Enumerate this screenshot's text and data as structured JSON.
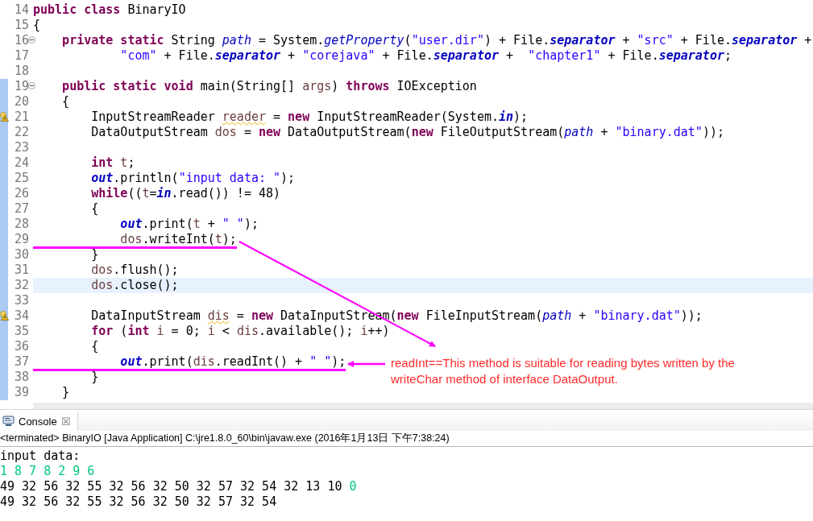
{
  "editor": {
    "lines": [
      {
        "number": "14",
        "changed": false,
        "fold": false,
        "warning": false,
        "current": false,
        "underlined": false,
        "tokens": [
          {
            "text": "public class",
            "kind": "keyword"
          },
          {
            "text": " BinaryIO",
            "kind": "plain"
          }
        ]
      },
      {
        "number": "15",
        "changed": false,
        "fold": false,
        "warning": false,
        "current": false,
        "underlined": false,
        "tokens": [
          {
            "text": "{",
            "kind": "plain"
          }
        ]
      },
      {
        "number": "16",
        "changed": false,
        "fold": true,
        "warning": false,
        "current": false,
        "underlined": false,
        "tokens": [
          {
            "text": "    private static",
            "kind": "keyword"
          },
          {
            "text": " String ",
            "kind": "plain"
          },
          {
            "text": "path",
            "kind": "italic"
          },
          {
            "text": " = System.",
            "kind": "plain"
          },
          {
            "text": "getProperty",
            "kind": "italic"
          },
          {
            "text": "(",
            "kind": "plain"
          },
          {
            "text": "\"user.dir\"",
            "kind": "string"
          },
          {
            "text": ") + File.",
            "kind": "plain"
          },
          {
            "text": "separator",
            "kind": "field"
          },
          {
            "text": " + ",
            "kind": "plain"
          },
          {
            "text": "\"src\"",
            "kind": "string"
          },
          {
            "text": " + File.",
            "kind": "plain"
          },
          {
            "text": "separator",
            "kind": "field"
          },
          {
            "text": " +",
            "kind": "plain"
          }
        ]
      },
      {
        "number": "17",
        "changed": false,
        "fold": false,
        "warning": false,
        "current": false,
        "underlined": false,
        "tokens": [
          {
            "text": "            \"com\"",
            "kind": "string"
          },
          {
            "text": " + File.",
            "kind": "plain"
          },
          {
            "text": "separator",
            "kind": "field"
          },
          {
            "text": " + ",
            "kind": "plain"
          },
          {
            "text": "\"corejava\"",
            "kind": "string"
          },
          {
            "text": " + File.",
            "kind": "plain"
          },
          {
            "text": "separator",
            "kind": "field"
          },
          {
            "text": " +  ",
            "kind": "plain"
          },
          {
            "text": "\"chapter1\"",
            "kind": "string"
          },
          {
            "text": " + File.",
            "kind": "plain"
          },
          {
            "text": "separator",
            "kind": "field"
          },
          {
            "text": ";",
            "kind": "plain"
          }
        ]
      },
      {
        "number": "18",
        "changed": false,
        "fold": false,
        "warning": false,
        "current": false,
        "underlined": false
      },
      {
        "number": "19",
        "changed": true,
        "fold": true,
        "warning": false,
        "current": false,
        "underlined": false,
        "tokens": [
          {
            "text": "    public static void",
            "kind": "keyword"
          },
          {
            "text": " main(String[] ",
            "kind": "plain"
          },
          {
            "text": "args",
            "kind": "variable"
          },
          {
            "text": ") ",
            "kind": "plain"
          },
          {
            "text": "throws",
            "kind": "keyword"
          },
          {
            "text": " IOException",
            "kind": "plain"
          }
        ]
      },
      {
        "number": "20",
        "changed": true,
        "fold": false,
        "warning": false,
        "current": false,
        "underlined": false,
        "tokens": [
          {
            "text": "    {",
            "kind": "plain"
          }
        ]
      },
      {
        "number": "21",
        "changed": true,
        "fold": false,
        "warning": true,
        "current": false,
        "underlined": false,
        "tokens": [
          {
            "text": "        InputStreamReader ",
            "kind": "plain"
          },
          {
            "text": "reader",
            "kind": "warned"
          },
          {
            "text": " = ",
            "kind": "plain"
          },
          {
            "text": "new",
            "kind": "keyword"
          },
          {
            "text": " InputStreamReader(System.",
            "kind": "plain"
          },
          {
            "text": "in",
            "kind": "field"
          },
          {
            "text": ");",
            "kind": "plain"
          }
        ]
      },
      {
        "number": "22",
        "changed": true,
        "fold": false,
        "warning": false,
        "current": false,
        "underlined": false,
        "tokens": [
          {
            "text": "        DataOutputStream ",
            "kind": "plain"
          },
          {
            "text": "dos",
            "kind": "variable"
          },
          {
            "text": " = ",
            "kind": "plain"
          },
          {
            "text": "new",
            "kind": "keyword"
          },
          {
            "text": " DataOutputStream(",
            "kind": "plain"
          },
          {
            "text": "new",
            "kind": "keyword"
          },
          {
            "text": " FileOutputStream(",
            "kind": "plain"
          },
          {
            "text": "path",
            "kind": "italic"
          },
          {
            "text": " + ",
            "kind": "plain"
          },
          {
            "text": "\"binary.dat\"",
            "kind": "string"
          },
          {
            "text": "));",
            "kind": "plain"
          }
        ]
      },
      {
        "number": "23",
        "changed": true,
        "fold": false,
        "warning": false,
        "current": false,
        "underlined": false
      },
      {
        "number": "24",
        "changed": true,
        "fold": false,
        "warning": false,
        "current": false,
        "underlined": false,
        "tokens": [
          {
            "text": "        int",
            "kind": "keyword"
          },
          {
            "text": " t",
            "kind": "variable"
          },
          {
            "text": ";",
            "kind": "plain"
          }
        ]
      },
      {
        "number": "25",
        "changed": true,
        "fold": false,
        "warning": false,
        "current": false,
        "underlined": false,
        "tokens": [
          {
            "text": "        out",
            "kind": "field"
          },
          {
            "text": ".println(",
            "kind": "plain"
          },
          {
            "text": "\"input data: \"",
            "kind": "string"
          },
          {
            "text": ");",
            "kind": "plain"
          }
        ]
      },
      {
        "number": "26",
        "changed": true,
        "fold": false,
        "warning": false,
        "current": false,
        "underlined": false,
        "tokens": [
          {
            "text": "        while",
            "kind": "keyword"
          },
          {
            "text": "((",
            "kind": "plain"
          },
          {
            "text": "t",
            "kind": "variable"
          },
          {
            "text": "=",
            "kind": "plain"
          },
          {
            "text": "in",
            "kind": "field"
          },
          {
            "text": ".read()) != 48)",
            "kind": "plain"
          }
        ]
      },
      {
        "number": "27",
        "changed": true,
        "fold": false,
        "warning": false,
        "current": false,
        "underlined": false,
        "tokens": [
          {
            "text": "        {",
            "kind": "plain"
          }
        ]
      },
      {
        "number": "28",
        "changed": true,
        "fold": false,
        "warning": false,
        "current": false,
        "underlined": false,
        "tokens": [
          {
            "text": "            out",
            "kind": "field"
          },
          {
            "text": ".print(",
            "kind": "plain"
          },
          {
            "text": "t",
            "kind": "variable"
          },
          {
            "text": " + ",
            "kind": "plain"
          },
          {
            "text": "\" \"",
            "kind": "string"
          },
          {
            "text": ");",
            "kind": "plain"
          }
        ]
      },
      {
        "number": "29",
        "changed": true,
        "fold": false,
        "warning": false,
        "current": false,
        "underlined": true,
        "tokens": [
          {
            "text": "            dos",
            "kind": "variable"
          },
          {
            "text": ".writeInt(",
            "kind": "plain"
          },
          {
            "text": "t",
            "kind": "variable"
          },
          {
            "text": ");",
            "kind": "plain"
          }
        ]
      },
      {
        "number": "30",
        "changed": true,
        "fold": false,
        "warning": false,
        "current": false,
        "underlined": false,
        "tokens": [
          {
            "text": "        }",
            "kind": "plain"
          }
        ]
      },
      {
        "number": "31",
        "changed": true,
        "fold": false,
        "warning": false,
        "current": false,
        "underlined": false,
        "tokens": [
          {
            "text": "        dos",
            "kind": "variable"
          },
          {
            "text": ".flush();",
            "kind": "plain"
          }
        ]
      },
      {
        "number": "32",
        "changed": true,
        "fold": false,
        "warning": false,
        "current": true,
        "underlined": false,
        "tokens": [
          {
            "text": "        dos",
            "kind": "variable"
          },
          {
            "text": ".close();",
            "kind": "plain"
          }
        ]
      },
      {
        "number": "33",
        "changed": true,
        "fold": false,
        "warning": false,
        "current": false,
        "underlined": false
      },
      {
        "number": "34",
        "changed": true,
        "fold": false,
        "warning": true,
        "current": false,
        "underlined": false,
        "tokens": [
          {
            "text": "        DataInputStream ",
            "kind": "plain"
          },
          {
            "text": "dis",
            "kind": "warned"
          },
          {
            "text": " = ",
            "kind": "plain"
          },
          {
            "text": "new",
            "kind": "keyword"
          },
          {
            "text": " DataInputStream(",
            "kind": "plain"
          },
          {
            "text": "new",
            "kind": "keyword"
          },
          {
            "text": " FileInputStream(",
            "kind": "plain"
          },
          {
            "text": "path",
            "kind": "italic"
          },
          {
            "text": " + ",
            "kind": "plain"
          },
          {
            "text": "\"binary.dat\"",
            "kind": "string"
          },
          {
            "text": "));",
            "kind": "plain"
          }
        ]
      },
      {
        "number": "35",
        "changed": true,
        "fold": false,
        "warning": false,
        "current": false,
        "underlined": false,
        "tokens": [
          {
            "text": "        for",
            "kind": "keyword"
          },
          {
            "text": " (",
            "kind": "plain"
          },
          {
            "text": "int",
            "kind": "keyword"
          },
          {
            "text": " i",
            "kind": "variable"
          },
          {
            "text": " = 0; ",
            "kind": "plain"
          },
          {
            "text": "i",
            "kind": "variable"
          },
          {
            "text": " < ",
            "kind": "plain"
          },
          {
            "text": "dis",
            "kind": "variable"
          },
          {
            "text": ".available(); ",
            "kind": "plain"
          },
          {
            "text": "i",
            "kind": "variable"
          },
          {
            "text": "++)",
            "kind": "plain"
          }
        ]
      },
      {
        "number": "36",
        "changed": true,
        "fold": false,
        "warning": false,
        "current": false,
        "underlined": false,
        "tokens": [
          {
            "text": "        {",
            "kind": "plain"
          }
        ]
      },
      {
        "number": "37",
        "changed": true,
        "fold": false,
        "warning": false,
        "current": false,
        "underlined": true,
        "tokens": [
          {
            "text": "            out",
            "kind": "field"
          },
          {
            "text": ".print(",
            "kind": "plain"
          },
          {
            "text": "dis",
            "kind": "variable"
          },
          {
            "text": ".readInt() + ",
            "kind": "plain"
          },
          {
            "text": "\" \"",
            "kind": "string"
          },
          {
            "text": ");",
            "kind": "plain"
          }
        ]
      },
      {
        "number": "38",
        "changed": true,
        "fold": false,
        "warning": false,
        "current": false,
        "underlined": false,
        "tokens": [
          {
            "text": "        }",
            "kind": "plain"
          }
        ]
      },
      {
        "number": "39",
        "changed": true,
        "fold": false,
        "warning": false,
        "current": false,
        "underlined": false,
        "tokens": [
          {
            "text": "    }",
            "kind": "plain"
          }
        ]
      }
    ]
  },
  "annotation": {
    "text": "readInt==This method is suitable for reading bytes written by the writeChar method of interface DataOutput."
  },
  "console": {
    "tab": {
      "label": "Console",
      "close": "☒",
      "selected": true
    },
    "status": "<terminated> BinaryIO [Java Application] C:\\jre1.8.0_60\\bin\\javaw.exe (2016年1月13日 下午7:38:24)",
    "lines": [
      [
        {
          "text": "input data:",
          "kind": "stdout"
        }
      ],
      [
        {
          "text": "1 8 7 8 2 9 6",
          "kind": "stdin"
        }
      ],
      [
        {
          "text": "49 32 56 32 55 32 56 32 50 32 57 32 54 32 13 10 ",
          "kind": "stdout"
        },
        {
          "text": "0",
          "kind": "stdin"
        }
      ],
      [
        {
          "text": "49 32 56 32 55 32 56 32 50 32 57 32 54",
          "kind": "stdout"
        }
      ]
    ]
  }
}
